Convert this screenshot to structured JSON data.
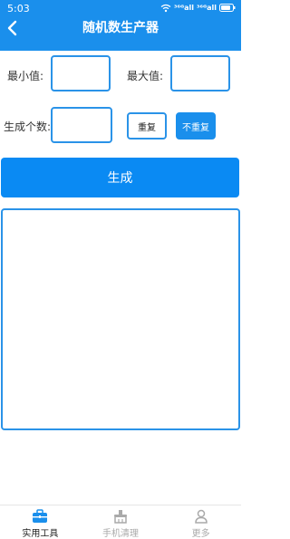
{
  "status_bar": {
    "time": "5:03",
    "signal1": "³⁶ᴳall",
    "signal2": "³⁶ᴳall"
  },
  "header": {
    "title": "随机数生产器",
    "back_icon": "chevron-left-icon"
  },
  "form": {
    "min_label": "最小值:",
    "max_label": "最大值:",
    "count_label": "生成个数:",
    "min_value": "",
    "max_value": "",
    "count_value": ""
  },
  "options": {
    "repeat_label": "重复",
    "no_repeat_label": "不重复",
    "selected": "不重复"
  },
  "generate_button": {
    "label": "生成"
  },
  "output": {
    "text": ""
  },
  "tabs": [
    {
      "label": "实用工具",
      "icon": "toolbox-icon",
      "active": true
    },
    {
      "label": "手机清理",
      "icon": "broom-icon",
      "active": false
    },
    {
      "label": "更多",
      "icon": "user-icon",
      "active": false
    }
  ],
  "colors": {
    "primary": "#1a8fec",
    "button": "#0a8af3",
    "inactive": "#aaaaaa"
  }
}
